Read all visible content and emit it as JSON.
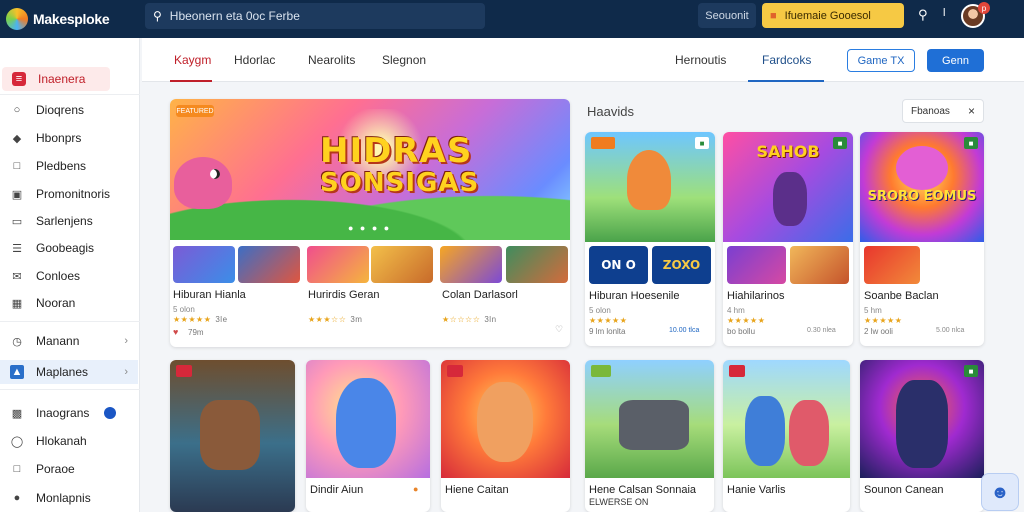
{
  "app": {
    "name": "Makesploke"
  },
  "search": {
    "value": "Hbeonern eta 0oc Ferbe"
  },
  "topbar": {
    "pill": "Seouonit",
    "promo": "Ifuemaie Gooesol",
    "user_initial": "l",
    "notification": "p"
  },
  "sidebar": {
    "items": [
      {
        "label": "Inaenera"
      },
      {
        "label": "Dioqrens"
      },
      {
        "label": "Hbonprs"
      },
      {
        "label": "Pledbens"
      },
      {
        "label": "Promonitnoris"
      },
      {
        "label": "Sarlenjens"
      },
      {
        "label": "Goobeagis"
      },
      {
        "label": "Conloes"
      },
      {
        "label": "Nooran"
      },
      {
        "label": "Manann"
      },
      {
        "label": "Maplanes"
      },
      {
        "label": "Inaograns"
      },
      {
        "label": "Hlokanah"
      },
      {
        "label": "Poraoe"
      },
      {
        "label": "Monlapnis"
      }
    ]
  },
  "tabs": {
    "items": [
      "Kaygm",
      "Hdorlac",
      "Nearolits",
      "Slegnon",
      "Hernoutis",
      "Fardcoks"
    ],
    "game_button": "Game TX",
    "primary_button": "Genn"
  },
  "featured": {
    "badge": "FEATURED",
    "hero_title_line1": "HIDRAS",
    "hero_title_line2": "SONSIGAS",
    "games": [
      {
        "title": "Hiburan Hianla",
        "sub": "5 olon",
        "rating": "★★★★★",
        "count": "3le",
        "meta": "79m"
      },
      {
        "title": "Hurirdis Geran",
        "sub": "",
        "rating": "★★★☆☆",
        "count": "3m"
      },
      {
        "title": "Colan Darlasorl",
        "sub": "",
        "rating": "★☆☆☆☆",
        "count": "3ln"
      }
    ]
  },
  "recommended": {
    "title": "Haavids",
    "filter_label": "Fbanoas",
    "cards": [
      {
        "title": "Hiburan Hoesenile",
        "sub": "5 olon",
        "stars": "★★★★★",
        "meta": "9 lm lonlta",
        "price": "10.00 tlca",
        "art_title": "",
        "chip_left": "ON O",
        "chip_right": "ZOXO"
      },
      {
        "title": "Hiahilarinos",
        "sub": "4 hm",
        "stars": "★★★★★",
        "meta": "bo bollu",
        "price": "0.30 nlea",
        "art_title": "SAHOB",
        "chip_left": "",
        "chip_right": ""
      },
      {
        "title": "Soanbe Baclan",
        "sub": "5 hm",
        "stars": "★★★★★",
        "meta": "2 lw ooli",
        "price": "5.00 nlca",
        "art_title": "SRORO EOMUS",
        "chip_left": "",
        "chip_right": ""
      }
    ],
    "bottom_cards": [
      {
        "title": "Dindir Aiun",
        "sub": ""
      },
      {
        "title": "Hiene Caitan",
        "sub": ""
      },
      {
        "title": "Hene Calsan Sonnaia",
        "sub": "ELWERSE ON"
      },
      {
        "title": "Hanie Varlis",
        "sub": ""
      },
      {
        "title": "Sounon Canean",
        "sub": ""
      }
    ]
  },
  "colors": {
    "topbar": "#0f2a4a",
    "accent": "#c0202a",
    "primary": "#1f6fd6",
    "promo": "#f6c944"
  },
  "icons": [
    "search-icon",
    "bell-icon",
    "avatar",
    "close-icon",
    "chevron-right-icon",
    "chat-assistant-icon"
  ]
}
